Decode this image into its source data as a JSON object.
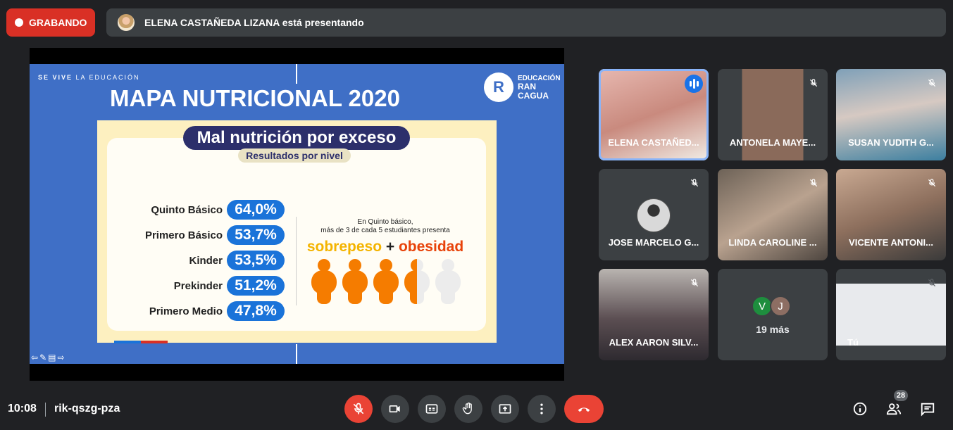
{
  "recording": {
    "label": "GRABANDO"
  },
  "presenting": {
    "text": "ELENA CASTAÑEDA LIZANA está presentando"
  },
  "slide": {
    "tag_bold": "SE VIVE",
    "tag_rest": " LA EDUCACIÓN",
    "title": "MAPA NUTRICIONAL 2020",
    "logo_letter": "R",
    "logo_line1": "EDUCACIÓN",
    "logo_line2": "RAN",
    "logo_line3": "CAGUA",
    "heading": "Mal nutrición por exceso",
    "subheading": "Resultados por nivel",
    "rows": [
      {
        "label": "Quinto Básico",
        "value": "64,0%"
      },
      {
        "label": "Primero Básico",
        "value": "53,7%"
      },
      {
        "label": "Kinder",
        "value": "53,5%"
      },
      {
        "label": "Prekinder",
        "value": "51,2%"
      },
      {
        "label": "Primero Medio",
        "value": "47,8%"
      }
    ],
    "note_line1": "En Quinto básico,",
    "note_line2": "más de 3 de cada 5 estudiantes presenta",
    "emph_a": "sobrepeso",
    "emph_plus": " + ",
    "emph_b": "obesidad"
  },
  "participants": [
    {
      "name": "ELENA CASTAÑED...",
      "muted": false,
      "speaking": true
    },
    {
      "name": "ANTONELA MAYE...",
      "muted": true
    },
    {
      "name": "SUSAN YUDITH G...",
      "muted": true
    },
    {
      "name": "JOSE MARCELO G...",
      "muted": true
    },
    {
      "name": "LINDA CAROLINE ...",
      "muted": true
    },
    {
      "name": "VICENTE ANTONI...",
      "muted": true
    },
    {
      "name": "ALEX AARON SILV...",
      "muted": true
    },
    {
      "name": "Tú",
      "muted": true
    }
  ],
  "more": {
    "initials": [
      "V",
      "J"
    ],
    "colors": [
      "#1e8e3e",
      "#8d6e63"
    ],
    "text": "19 más"
  },
  "footer": {
    "time": "10:08",
    "meeting_code": "rik-qszg-pza",
    "people_count": "28"
  }
}
